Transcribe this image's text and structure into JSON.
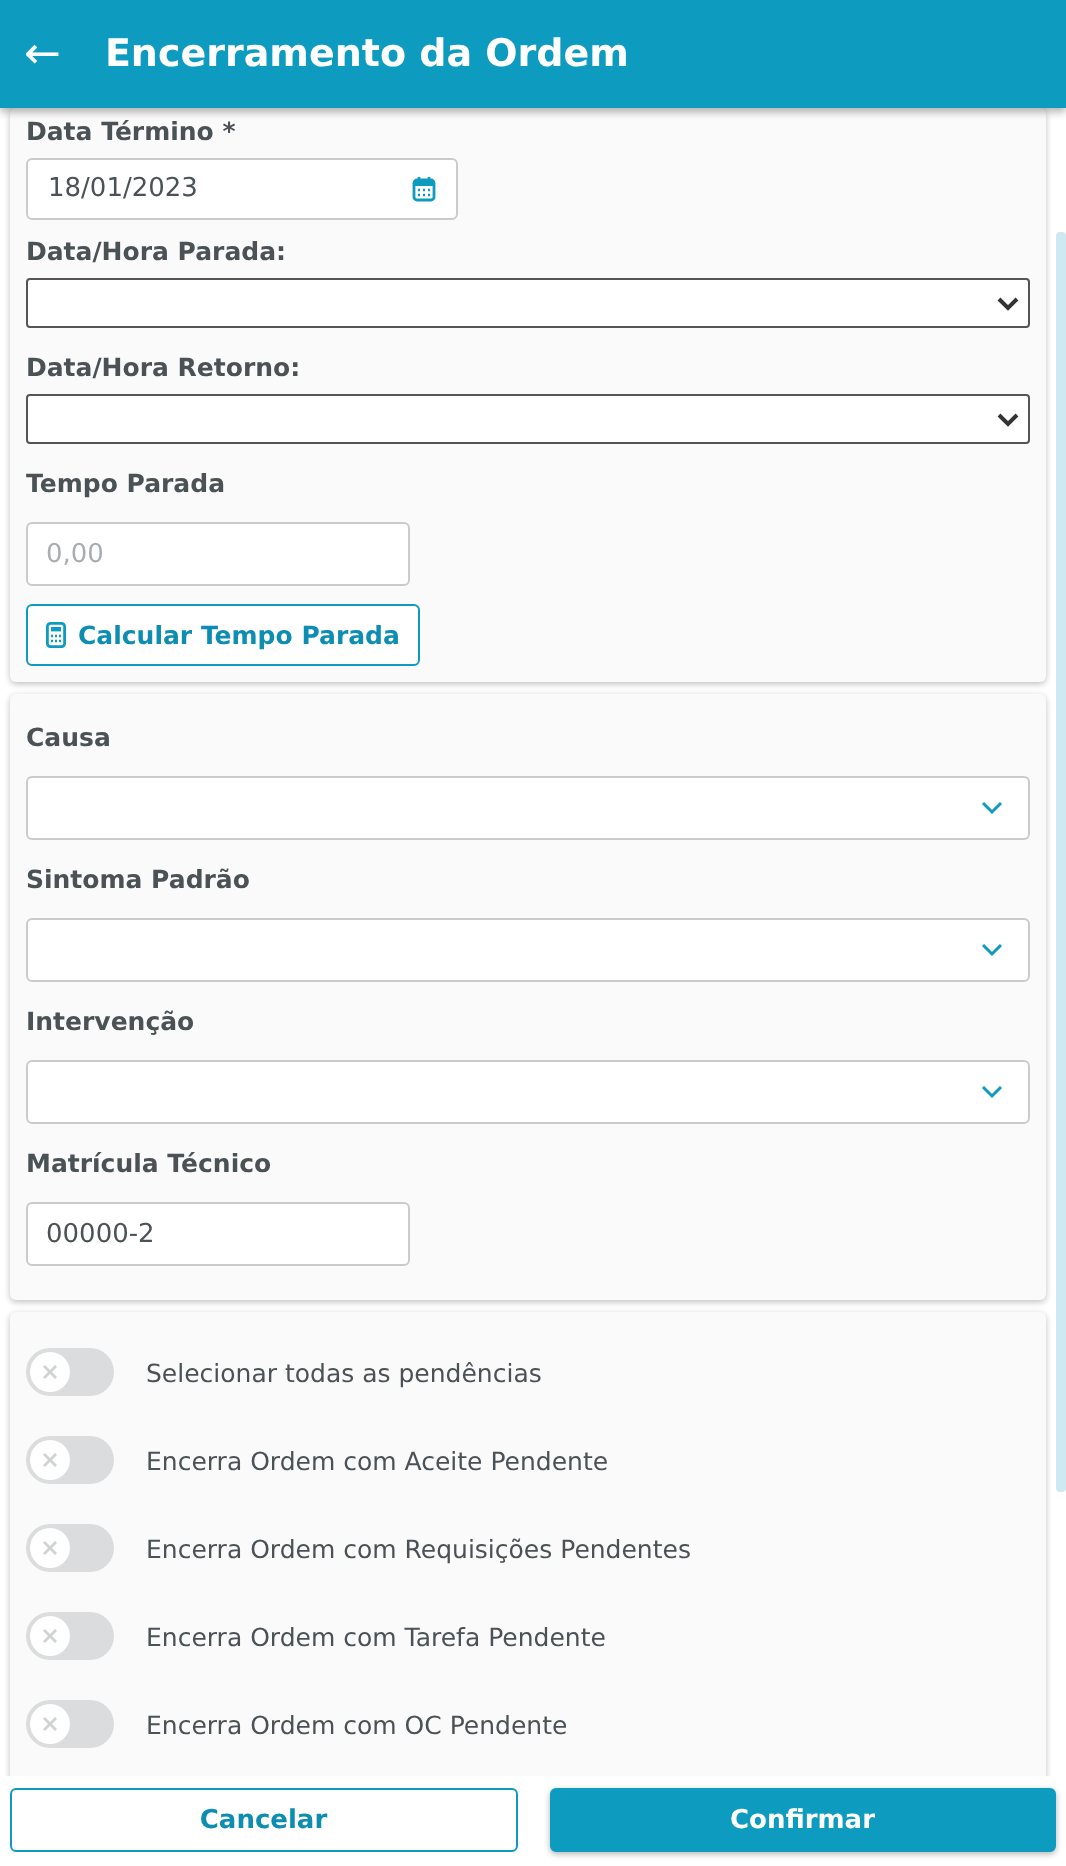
{
  "header": {
    "back": "←",
    "title": "Encerramento da Ordem"
  },
  "sections": [
    {
      "fields": [
        {
          "kind": "date",
          "label": "Data Término *",
          "value": "18/01/2023"
        },
        {
          "kind": "native_select",
          "label": "Data/Hora Parada:"
        },
        {
          "kind": "native_select",
          "label": "Data/Hora Retorno:"
        },
        {
          "kind": "text",
          "label": "Tempo Parada",
          "placeholder": "0,00"
        },
        {
          "kind": "action",
          "label": "Calcular Tempo Parada"
        }
      ]
    },
    {
      "fields": [
        {
          "kind": "combo",
          "label": "Causa"
        },
        {
          "kind": "combo",
          "label": "Sintoma Padrão"
        },
        {
          "kind": "combo",
          "label": "Intervenção"
        },
        {
          "kind": "text",
          "label": "Matrícula Técnico",
          "value": "00000-2"
        }
      ]
    }
  ],
  "switches": [
    {
      "label": "Selecionar todas as pendências",
      "on": false
    },
    {
      "label": "Encerra Ordem com Aceite Pendente",
      "on": false
    },
    {
      "label": "Encerra Ordem com Requisições Pendentes",
      "on": false
    },
    {
      "label": "Encerra Ordem com Tarefa Pendente",
      "on": false
    },
    {
      "label": "Encerra Ordem com OC Pendente",
      "on": false
    }
  ],
  "buttons": [
    {
      "kind": "secondary",
      "label": "Cancelar"
    },
    {
      "kind": "primary",
      "label": "Confirmar"
    }
  ]
}
